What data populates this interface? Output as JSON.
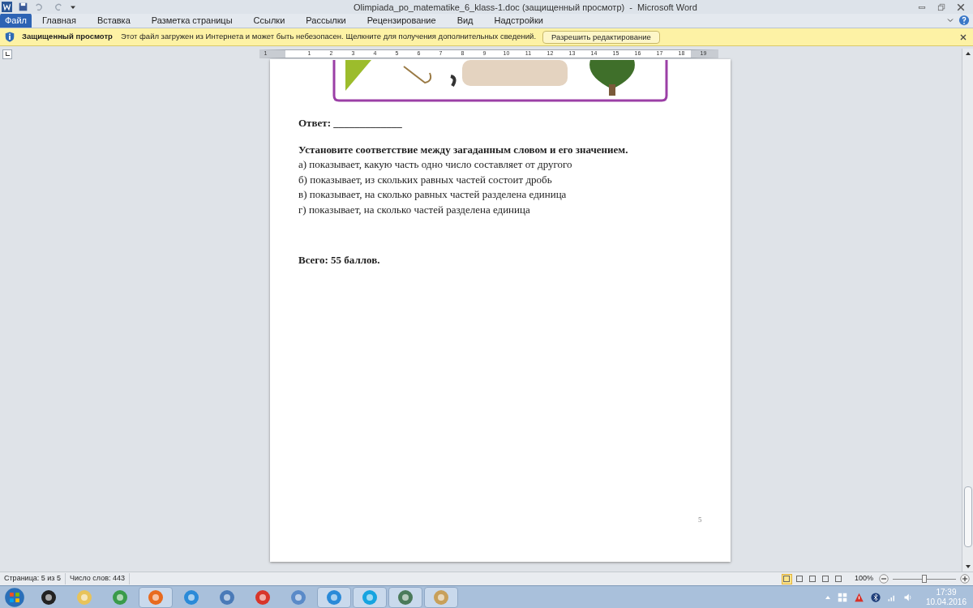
{
  "window": {
    "title": "Olimpiada_po_matematike_6_klass-1.doc (защищенный просмотр)  -  Microsoft Word"
  },
  "file_button": {
    "label": "Файл"
  },
  "tabs": [
    {
      "label": "Главная",
      "selected": false
    },
    {
      "label": "Вставка",
      "selected": false
    },
    {
      "label": "Разметка страницы",
      "selected": false
    },
    {
      "label": "Ссылки",
      "selected": false
    },
    {
      "label": "Рассылки",
      "selected": false
    },
    {
      "label": "Рецензирование",
      "selected": false
    },
    {
      "label": "Вид",
      "selected": false
    },
    {
      "label": "Надстройки",
      "selected": false
    }
  ],
  "message_bar": {
    "title": "Защищенный просмотр",
    "text": "Этот файл загружен из Интернета и может быть небезопасен. Щелкните для получения дополнительных сведений.",
    "button": "Разрешить редактирование"
  },
  "ruler": {
    "labels": [
      "1",
      "1",
      "2",
      "3",
      "4",
      "5",
      "6",
      "7",
      "8",
      "9",
      "10",
      "11",
      "12",
      "13",
      "14",
      "15",
      "16",
      "17",
      "18",
      "19"
    ]
  },
  "document": {
    "answer": "Ответ: _____________",
    "task": "Установите соответствие между загаданным словом и его значением.",
    "items": [
      "а) показывает, какую часть одно число составляет от другого",
      "б) показывает, из скольких равных частей состоит дробь",
      "в) показывает, на сколько равных частей разделена единица",
      "г) показывает, на сколько частей разделена единица"
    ],
    "total": "Всего: 55 баллов.",
    "page_number": "5"
  },
  "status_bar": {
    "page": "Страница: 5 из 5",
    "words": "Число слов: 443",
    "views": [
      {
        "selected": true
      },
      {
        "selected": false
      },
      {
        "selected": false
      },
      {
        "selected": false
      },
      {
        "selected": false
      }
    ],
    "zoom": "100%",
    "zoom_slider": {
      "level": 0.5
    }
  },
  "taskbar": {
    "time": "17:39",
    "date": "10.04.2016"
  }
}
